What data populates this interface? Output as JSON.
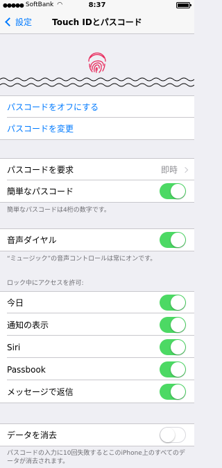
{
  "status_bar": {
    "carrier": "SoftBank",
    "time": "8:37"
  },
  "nav": {
    "back_label": "設定",
    "title": "Touch IDとパスコード"
  },
  "passcode_actions": [
    {
      "label": "パスコードをオフにする"
    },
    {
      "label": "パスコードを変更"
    }
  ],
  "require_passcode": {
    "label": "パスコードを要求",
    "value": "即時"
  },
  "simple_passcode": {
    "label": "簡単なパスコード",
    "on": true,
    "note": "簡単なパスコードは4桁の数字です。"
  },
  "voice_dial": {
    "label": "音声ダイヤル",
    "on": true,
    "note": "“ミュージック”の音声コントロールは常にオンです。"
  },
  "lock_access": {
    "header": "ロック中にアクセスを許可:",
    "items": [
      {
        "label": "今日",
        "on": true
      },
      {
        "label": "通知の表示",
        "on": true
      },
      {
        "label": "Siri",
        "on": true
      },
      {
        "label": "Passbook",
        "on": true
      },
      {
        "label": "メッセージで返信",
        "on": true
      }
    ]
  },
  "erase_data": {
    "label": "データを消去",
    "on": false,
    "note": "パスコードの入力に10回失敗するとこのiPhone上のすべてのデータが消去されます。"
  },
  "colors": {
    "accent": "#007aff",
    "toggle_on": "#4cd964",
    "fingerprint": "#e8285a"
  }
}
